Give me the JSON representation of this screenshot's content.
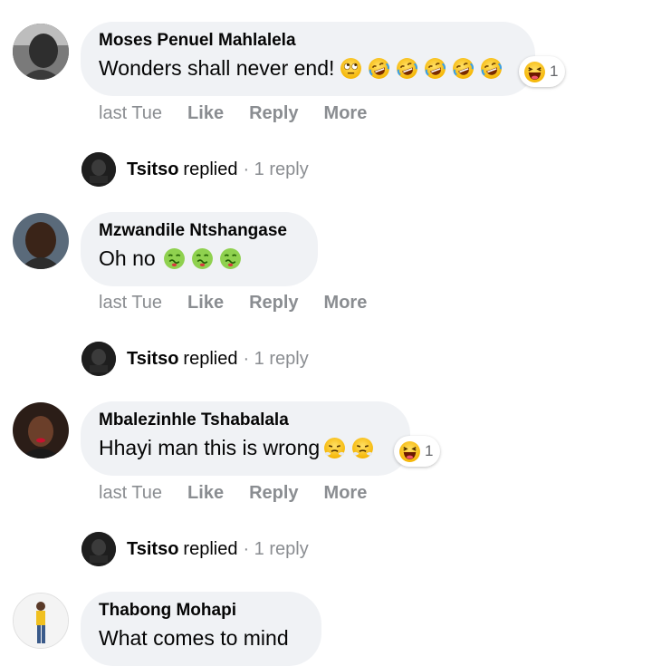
{
  "comments": [
    {
      "author": "Moses Penuel Mahlalela",
      "text": "Wonders shall never end!",
      "emojis": [
        "face-with-rolling-eyes-icon",
        "rolling-on-floor-laughing-icon",
        "rolling-on-floor-laughing-icon",
        "rolling-on-floor-laughing-icon",
        "rolling-on-floor-laughing-icon",
        "rolling-on-floor-laughing-icon"
      ],
      "reaction": {
        "icon": "haha-reaction-icon",
        "count": "1"
      },
      "time": "last Tue",
      "like": "Like",
      "reply": "Reply",
      "more": "More",
      "replies": {
        "name": "Tsitso",
        "verb": "replied",
        "count": "· 1 reply"
      }
    },
    {
      "author": "Mzwandile Ntshangase",
      "text": "Oh no",
      "emojis": [
        "nauseated-face-icon",
        "nauseated-face-icon",
        "nauseated-face-icon"
      ],
      "time": "last Tue",
      "like": "Like",
      "reply": "Reply",
      "more": "More",
      "replies": {
        "name": "Tsitso",
        "verb": "replied",
        "count": "· 1 reply"
      }
    },
    {
      "author": "Mbalezinhle Tshabalala",
      "text": "Hhayi man this is wrong",
      "emojis": [
        "face-with-steam-icon",
        "face-with-steam-icon"
      ],
      "reaction": {
        "icon": "haha-reaction-icon",
        "count": "1"
      },
      "time": "last Tue",
      "like": "Like",
      "reply": "Reply",
      "more": "More",
      "replies": {
        "name": "Tsitso",
        "verb": "replied",
        "count": "· 1 reply"
      }
    },
    {
      "author": "Thabong Mohapi",
      "text": "What comes to mind"
    }
  ],
  "colors": {
    "bubble": "#f0f2f5",
    "meta": "#8a8d91",
    "text": "#050505",
    "emoji_yellow": "#ffcc33",
    "emoji_green": "#7cc242"
  }
}
